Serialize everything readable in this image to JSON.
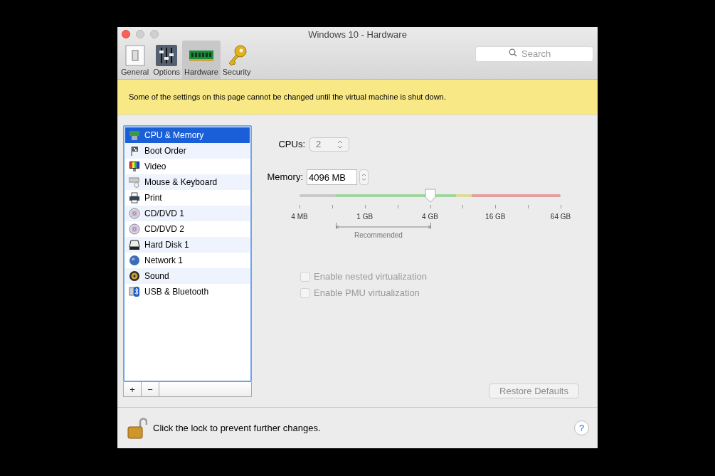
{
  "window": {
    "title": "Windows 10 - Hardware"
  },
  "toolbar": [
    {
      "label": "General",
      "kind": "switch",
      "selected": false
    },
    {
      "label": "Options",
      "kind": "sliders",
      "selected": false
    },
    {
      "label": "Hardware",
      "kind": "ram",
      "selected": true
    },
    {
      "label": "Security",
      "kind": "key",
      "selected": false
    }
  ],
  "search": {
    "placeholder": "Search"
  },
  "notice": "Some of the settings on this page cannot be changed until the virtual machine is shut down.",
  "devices": [
    {
      "label": "CPU & Memory",
      "kind": "cpu",
      "selected": true
    },
    {
      "label": "Boot Order",
      "kind": "boot",
      "selected": false
    },
    {
      "label": "Video",
      "kind": "video",
      "selected": false
    },
    {
      "label": "Mouse & Keyboard",
      "kind": "keyboard",
      "selected": false
    },
    {
      "label": "Print",
      "kind": "printer",
      "selected": false
    },
    {
      "label": "CD/DVD 1",
      "kind": "disc",
      "selected": false
    },
    {
      "label": "CD/DVD 2",
      "kind": "disc",
      "selected": false
    },
    {
      "label": "Hard Disk 1",
      "kind": "disk",
      "selected": false
    },
    {
      "label": "Network 1",
      "kind": "globe",
      "selected": false
    },
    {
      "label": "Sound",
      "kind": "speaker",
      "selected": false
    },
    {
      "label": "USB & Bluetooth",
      "kind": "usb",
      "selected": false
    }
  ],
  "list_buttons": [
    "+",
    "−"
  ],
  "cpus": {
    "label": "CPUs:",
    "value": "2",
    "disabled": true
  },
  "memory": {
    "label": "Memory:",
    "value": "4096 MB",
    "level": 0.5,
    "ticks": [
      "4 MB",
      "1 GB",
      "4 GB",
      "16 GB",
      "64 GB"
    ],
    "recommended": "Recommended"
  },
  "options": [
    {
      "label": "Enable nested virtualization",
      "checked": false,
      "disabled": true
    },
    {
      "label": "Enable PMU virtualization",
      "checked": false,
      "disabled": true
    }
  ],
  "restore_button": "Restore Defaults",
  "footer": {
    "text": "Click the lock to prevent further changes.",
    "help": "?"
  }
}
